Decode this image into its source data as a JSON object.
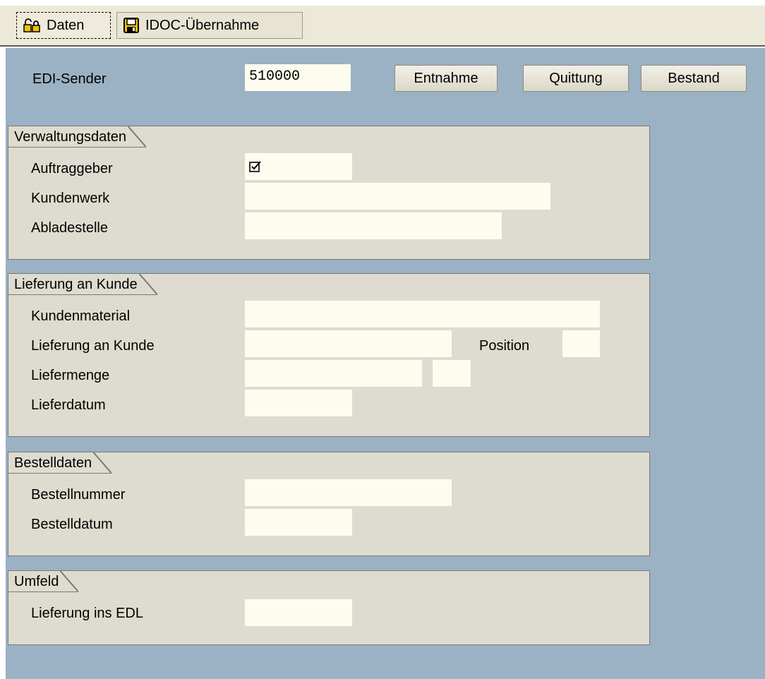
{
  "toolbar": {
    "daten_label": "Daten",
    "idoc_label": "IDOC-Übernahme"
  },
  "header": {
    "edi_sender_label": "EDI-Sender",
    "edi_sender_value": "510000",
    "entnahme_label": "Entnahme",
    "quittung_label": "Quittung",
    "bestand_label": "Bestand"
  },
  "verwaltungsdaten": {
    "title": "Verwaltungsdaten",
    "auftraggeber_label": "Auftraggeber",
    "auftraggeber_checked": true,
    "kundenwerk_label": "Kundenwerk",
    "abladestelle_label": "Abladestelle"
  },
  "lieferung": {
    "title": "Lieferung an Kunde",
    "kundenmaterial_label": "Kundenmaterial",
    "lieferung_label": "Lieferung an Kunde",
    "position_label": "Position",
    "liefermenge_label": "Liefermenge",
    "lieferdatum_label": "Lieferdatum"
  },
  "bestelldaten": {
    "title": "Bestelldaten",
    "bestellnummer_label": "Bestellnummer",
    "bestelldatum_label": "Bestelldatum"
  },
  "umfeld": {
    "title": "Umfeld",
    "lieferung_edl_label": "Lieferung ins EDL"
  },
  "colors": {
    "background": "#9bb1c4",
    "group": "#dedbd0",
    "field": "#fdfcef"
  }
}
